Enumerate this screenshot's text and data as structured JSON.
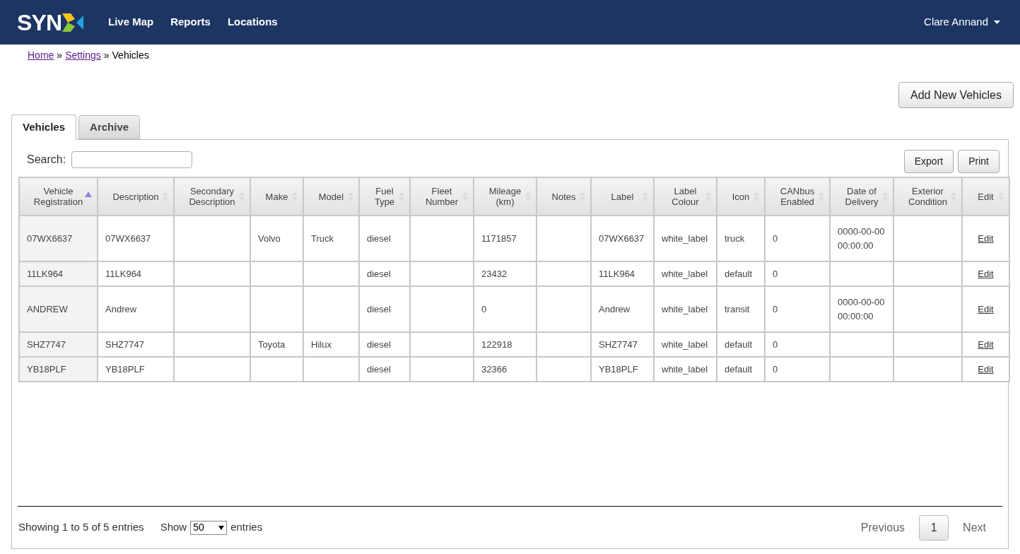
{
  "navbar": {
    "logo_text": "SYN",
    "links": [
      "Live Map",
      "Reports",
      "Locations"
    ],
    "user": "Clare Annand"
  },
  "breadcrumb": [
    {
      "label": "Home",
      "kind": "link"
    },
    {
      "label": "»",
      "kind": "separator"
    },
    {
      "label": "Settings",
      "kind": "link"
    },
    {
      "label": "»",
      "kind": "separator"
    },
    {
      "label": "Vehicles",
      "kind": "current"
    }
  ],
  "add_button": "Add New Vehicles",
  "tabs": [
    {
      "label": "Vehicles",
      "selected": true
    },
    {
      "label": "Archive",
      "selected": false
    }
  ],
  "search": {
    "label": "Search:"
  },
  "actions": [
    "Export",
    "Print"
  ],
  "table": {
    "columns": [
      {
        "label": "Vehicle Registration",
        "sorted": true
      },
      {
        "label": "Description",
        "sorted": false
      },
      {
        "label": "Secondary Description",
        "sorted": false
      },
      {
        "label": "Make",
        "sorted": false
      },
      {
        "label": "Model",
        "sorted": false
      },
      {
        "label": "Fuel Type",
        "sorted": false
      },
      {
        "label": "Fleet Number",
        "sorted": false
      },
      {
        "label": "Mileage (km)",
        "sorted": false
      },
      {
        "label": "Notes",
        "sorted": false
      },
      {
        "label": "Label",
        "sorted": false
      },
      {
        "label": "Label Colour",
        "sorted": false
      },
      {
        "label": "Icon",
        "sorted": false
      },
      {
        "label": "CANbus Enabled",
        "sorted": false
      },
      {
        "label": "Date of Delivery",
        "sorted": false
      },
      {
        "label": "Exterior Condition",
        "sorted": false
      },
      {
        "label": "Edit",
        "sorted": false
      }
    ],
    "rows": [
      [
        "07WX6637",
        "07WX6637",
        "",
        "Volvo",
        "Truck",
        "diesel",
        "",
        "1171857",
        "",
        "07WX6637",
        "white_label",
        "truck",
        "0",
        "0000-00-00 00:00:00",
        "",
        "Edit"
      ],
      [
        "11LK964",
        "11LK964",
        "",
        "",
        "",
        "diesel",
        "",
        "23432",
        "",
        "11LK964",
        "white_label",
        "default",
        "0",
        "",
        "",
        "Edit"
      ],
      [
        "ANDREW",
        "Andrew",
        "",
        "",
        "",
        "diesel",
        "",
        "0",
        "",
        "Andrew",
        "white_label",
        "transit",
        "0",
        "0000-00-00 00:00:00",
        "",
        "Edit"
      ],
      [
        "SHZ7747",
        "SHZ7747",
        "",
        "Toyota",
        "Hilux",
        "diesel",
        "",
        "122918",
        "",
        "SHZ7747",
        "white_label",
        "default",
        "0",
        "",
        "",
        "Edit"
      ],
      [
        "YB18PLF",
        "YB18PLF",
        "",
        "",
        "",
        "diesel",
        "",
        "32366",
        "",
        "YB18PLF",
        "white_label",
        "default",
        "0",
        "",
        "",
        "Edit"
      ]
    ]
  },
  "footer": {
    "info": "Showing 1 to 5 of 5 entries",
    "show_label": "Show",
    "page_length": "50",
    "entries_label": "entries",
    "previous": "Previous",
    "pages": [
      {
        "label": "1",
        "selected": true
      }
    ],
    "next": "Next"
  }
}
